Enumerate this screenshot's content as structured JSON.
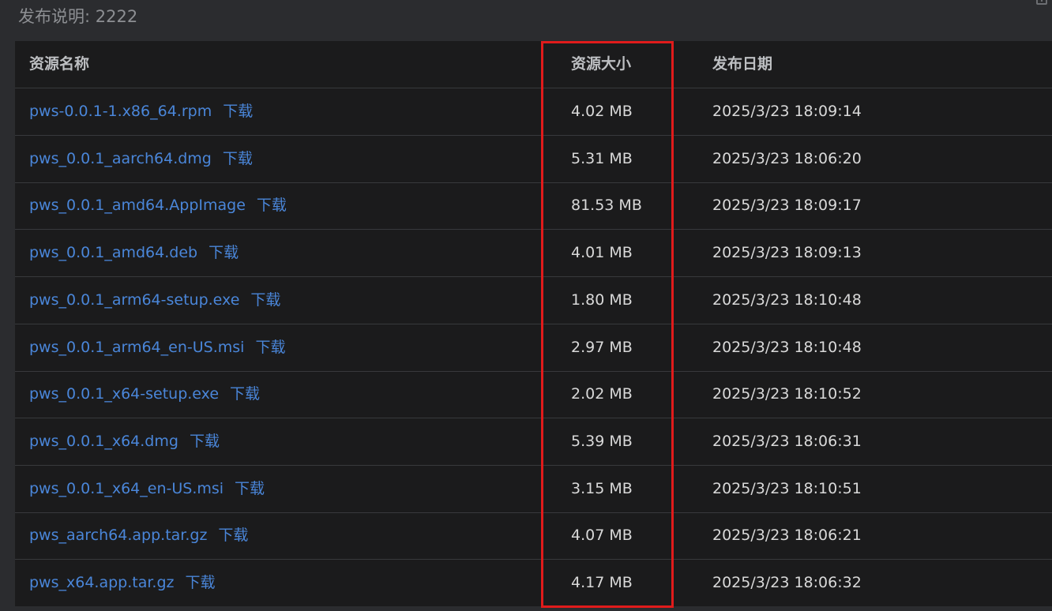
{
  "release": {
    "label": "发布说明: 2222"
  },
  "table": {
    "headers": {
      "name": "资源名称",
      "size": "资源大小",
      "date": "发布日期"
    },
    "download_label": "下载",
    "rows": [
      {
        "name": "pws-0.0.1-1.x86_64.rpm",
        "size": "4.02 MB",
        "date": "2025/3/23 18:09:14"
      },
      {
        "name": "pws_0.0.1_aarch64.dmg",
        "size": "5.31 MB",
        "date": "2025/3/23 18:06:20"
      },
      {
        "name": "pws_0.0.1_amd64.AppImage",
        "size": "81.53 MB",
        "date": "2025/3/23 18:09:17"
      },
      {
        "name": "pws_0.0.1_amd64.deb",
        "size": "4.01 MB",
        "date": "2025/3/23 18:09:13"
      },
      {
        "name": "pws_0.0.1_arm64-setup.exe",
        "size": "1.80 MB",
        "date": "2025/3/23 18:10:48"
      },
      {
        "name": "pws_0.0.1_arm64_en-US.msi",
        "size": "2.97 MB",
        "date": "2025/3/23 18:10:48"
      },
      {
        "name": "pws_0.0.1_x64-setup.exe",
        "size": "2.02 MB",
        "date": "2025/3/23 18:10:52"
      },
      {
        "name": "pws_0.0.1_x64.dmg",
        "size": "5.39 MB",
        "date": "2025/3/23 18:06:31"
      },
      {
        "name": "pws_0.0.1_x64_en-US.msi",
        "size": "3.15 MB",
        "date": "2025/3/23 18:10:51"
      },
      {
        "name": "pws_aarch64.app.tar.gz",
        "size": "4.07 MB",
        "date": "2025/3/23 18:06:21"
      },
      {
        "name": "pws_x64.app.tar.gz",
        "size": "4.17 MB",
        "date": "2025/3/23 18:06:32"
      }
    ]
  },
  "colors": {
    "link": "#4a86d9",
    "highlight": "#e01b1b",
    "table_bg": "#1b1b1c",
    "page_bg": "#2b2c2f"
  }
}
